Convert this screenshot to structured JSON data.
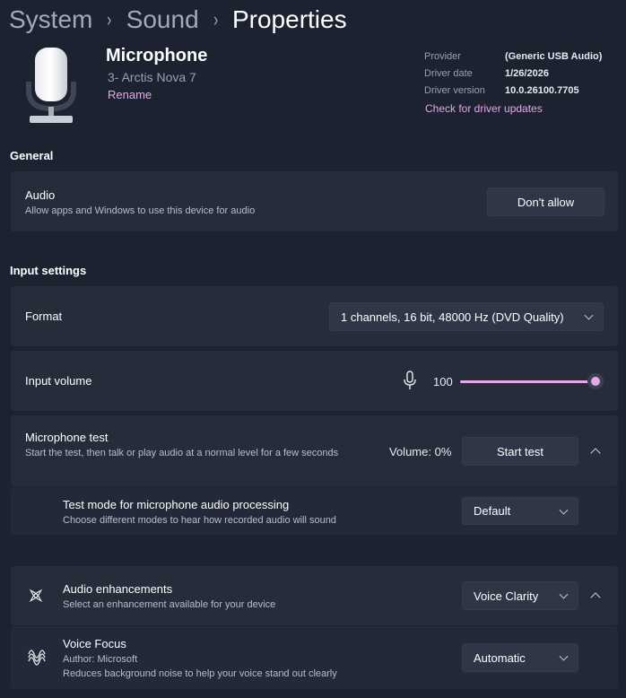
{
  "breadcrumb": {
    "items": [
      "System",
      "Sound",
      "Properties"
    ],
    "separator": "›"
  },
  "device": {
    "name": "Microphone",
    "subtitle": "3- Arctis Nova 7",
    "rename_label": "Rename",
    "icon": "microphone-device-icon"
  },
  "driver_info": {
    "provider_label": "Provider",
    "provider_value": "(Generic USB Audio)",
    "date_label": "Driver date",
    "date_value": "1/26/2026",
    "version_label": "Driver version",
    "version_value": "10.0.26100.7705",
    "update_link": "Check for driver updates"
  },
  "general": {
    "title": "General",
    "audio": {
      "title": "Audio",
      "description": "Allow apps and Windows to use this device for audio",
      "button": "Don't allow"
    }
  },
  "input_settings": {
    "title": "Input settings",
    "format": {
      "label": "Format",
      "value": "1 channels, 16 bit, 48000 Hz (DVD Quality)"
    },
    "volume": {
      "label": "Input volume",
      "value": "100",
      "level": 100,
      "icon": "microphone-icon"
    },
    "mic_test": {
      "title": "Microphone test",
      "description": "Start the test, then talk or play audio at a normal level for a few seconds",
      "volume_text": "Volume: 0%",
      "button": "Start test"
    },
    "test_mode": {
      "title": "Test mode for microphone audio processing",
      "description": "Choose different modes to hear how recorded audio will sound",
      "value": "Default"
    }
  },
  "enhancements": {
    "title": "Audio enhancements",
    "description": "Select an enhancement available for your device",
    "value": "Voice Clarity",
    "icon": "sparkle-icon"
  },
  "voice_focus": {
    "title": "Voice Focus",
    "author": "Author: Microsoft",
    "description": "Reduces background noise to help your voice stand out clearly",
    "value": "Automatic",
    "icon": "voice-focus-icon"
  },
  "colors": {
    "accent": "#e7a8e9",
    "background": "#1c2230",
    "card": "#262c3a"
  }
}
